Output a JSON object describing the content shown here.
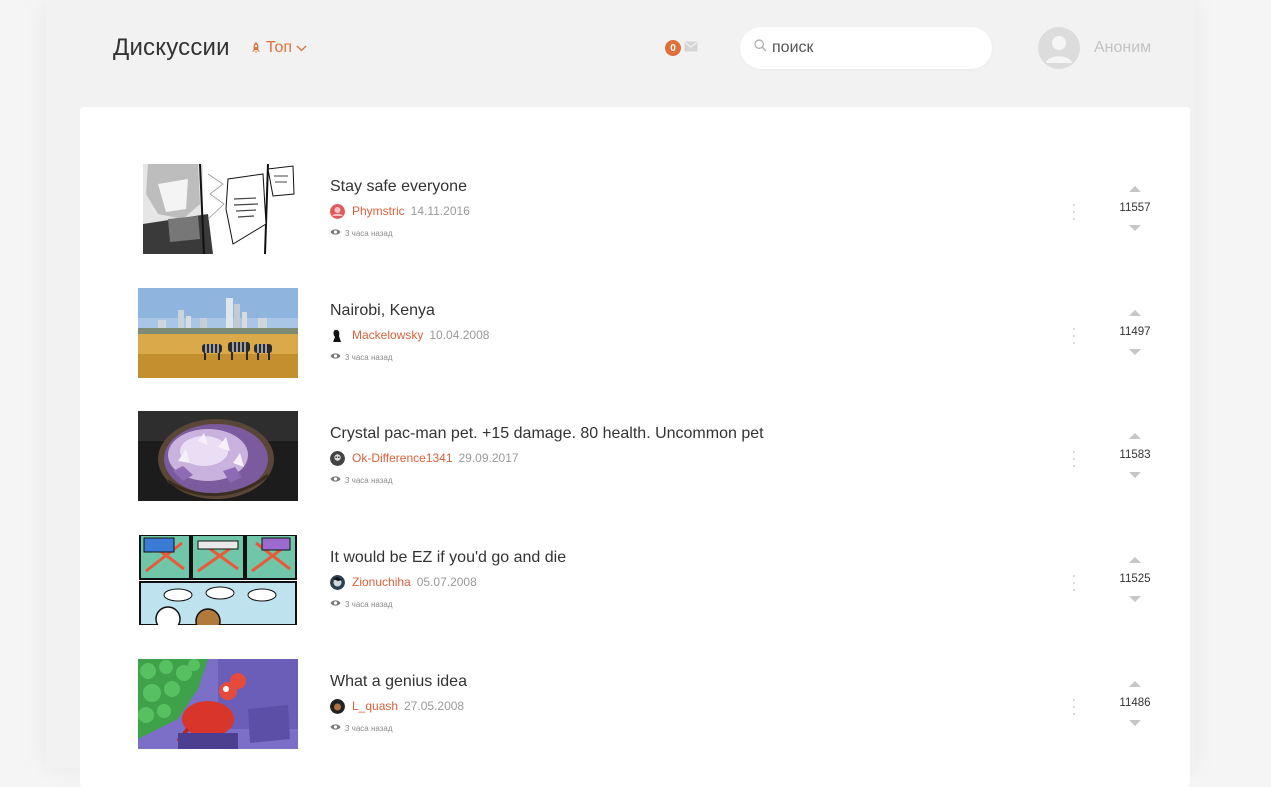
{
  "header": {
    "title": "Дискуссии",
    "sort_label": "Топ",
    "sort_icon": "rocket-icon",
    "notifications_count": "0",
    "search_placeholder": "поиск",
    "user_name": "Аноним"
  },
  "colors": {
    "accent": "#e0703a",
    "author": "#d8613a",
    "background": "#f2f2f2"
  },
  "posts": [
    {
      "title": "Stay safe everyone",
      "author": "Phymstric",
      "date": "14.11.2016",
      "views": "3 часа назад",
      "score": "11557",
      "thumb": "manga-panel-image"
    },
    {
      "title": "Nairobi, Kenya",
      "author": "Mackelowsky",
      "date": "10.04.2008",
      "views": "3 часа назад",
      "score": "11497",
      "thumb": "savanna-city-zebras-image"
    },
    {
      "title": "Crystal pac-man pet. +15 damage. 80 health. Uncommon pet",
      "author": "Ok-Difference1341",
      "date": "29.09.2017",
      "views": "3 часа назад",
      "score": "11583",
      "thumb": "amethyst-geode-image"
    },
    {
      "title": "It would be EZ if you'd go and die",
      "author": "Zionuchiha",
      "date": "05.07.2008",
      "views": "3 часа назад",
      "score": "11525",
      "thumb": "comic-strip-image"
    },
    {
      "title": "What a genius idea",
      "author": "L_quash",
      "date": "27.05.2008",
      "views": "3 часа назад",
      "score": "11486",
      "thumb": "cartoon-crab-money-image"
    }
  ]
}
